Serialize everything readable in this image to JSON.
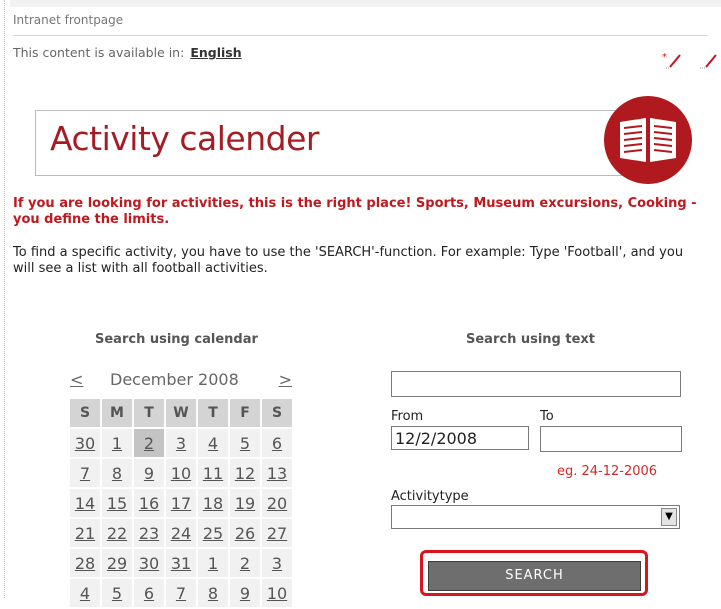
{
  "breadcrumb": "Intranet frontpage",
  "availability": {
    "text": "This content is available in:",
    "language": "English"
  },
  "banner": {
    "title": "Activity calender"
  },
  "intro": {
    "highlight": "If you are looking for activities, this is the right place! Sports, Museum excursions, Cooking - you define the limits.",
    "body": "To find a specific activity, you have to use the 'SEARCH'-function. For example: Type 'Football', and you will see a list with all football activities."
  },
  "calendar": {
    "heading": "Search using calendar",
    "prev": "<",
    "month": "December 2008",
    "next": ">",
    "weekdays": [
      "S",
      "M",
      "T",
      "W",
      "T",
      "F",
      "S"
    ],
    "weeks": [
      [
        "30",
        "1",
        "2",
        "3",
        "4",
        "5",
        "6"
      ],
      [
        "7",
        "8",
        "9",
        "10",
        "11",
        "12",
        "13"
      ],
      [
        "14",
        "15",
        "16",
        "17",
        "18",
        "19",
        "20"
      ],
      [
        "21",
        "22",
        "23",
        "24",
        "25",
        "26",
        "27"
      ],
      [
        "28",
        "29",
        "30",
        "31",
        "1",
        "2",
        "3"
      ],
      [
        "4",
        "5",
        "6",
        "7",
        "8",
        "9",
        "10"
      ]
    ],
    "selected": "2"
  },
  "text_search": {
    "heading": "Search using text",
    "query": "",
    "from_label": "From",
    "from_value": "12/2/2008",
    "to_label": "To",
    "to_value": "",
    "date_hint": "eg. 24-12-2006",
    "activitytype_label": "Activitytype",
    "activitytype_value": "",
    "search_label": "SEARCH"
  },
  "colors": {
    "brand_red": "#a51d24",
    "highlight_red": "#d9141c",
    "button_gray": "#6e6e6e"
  }
}
